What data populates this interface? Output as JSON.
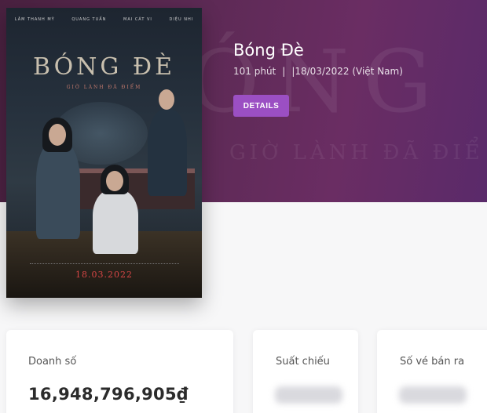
{
  "movie": {
    "title": "Bóng Đè",
    "duration": "101 phút",
    "separator": "|",
    "release": "|18/03/2022 (Việt Nam)",
    "details_label": "DETAILS"
  },
  "poster": {
    "title": "BÓNG ĐÈ",
    "tagline": "GIỜ LÀNH ĐÃ ĐIỂM",
    "date": "18.03.2022",
    "cast": [
      "LÂM THANH MỸ",
      "QUANG TUẤN",
      "MAI CÁT VI",
      "DIỆU NHI"
    ]
  },
  "backdrop": {
    "big": "ÓNG",
    "sub": "GIỜ LÀNH ĐÃ ĐIỂ"
  },
  "stats": {
    "revenue_label": "Doanh số",
    "revenue_value": "16,948,796,905₫",
    "screenings_label": "Suất chiếu",
    "tickets_label": "Số vé bán ra"
  },
  "colors": {
    "hero": "#5d2a55",
    "accent": "#9b4fc3"
  }
}
